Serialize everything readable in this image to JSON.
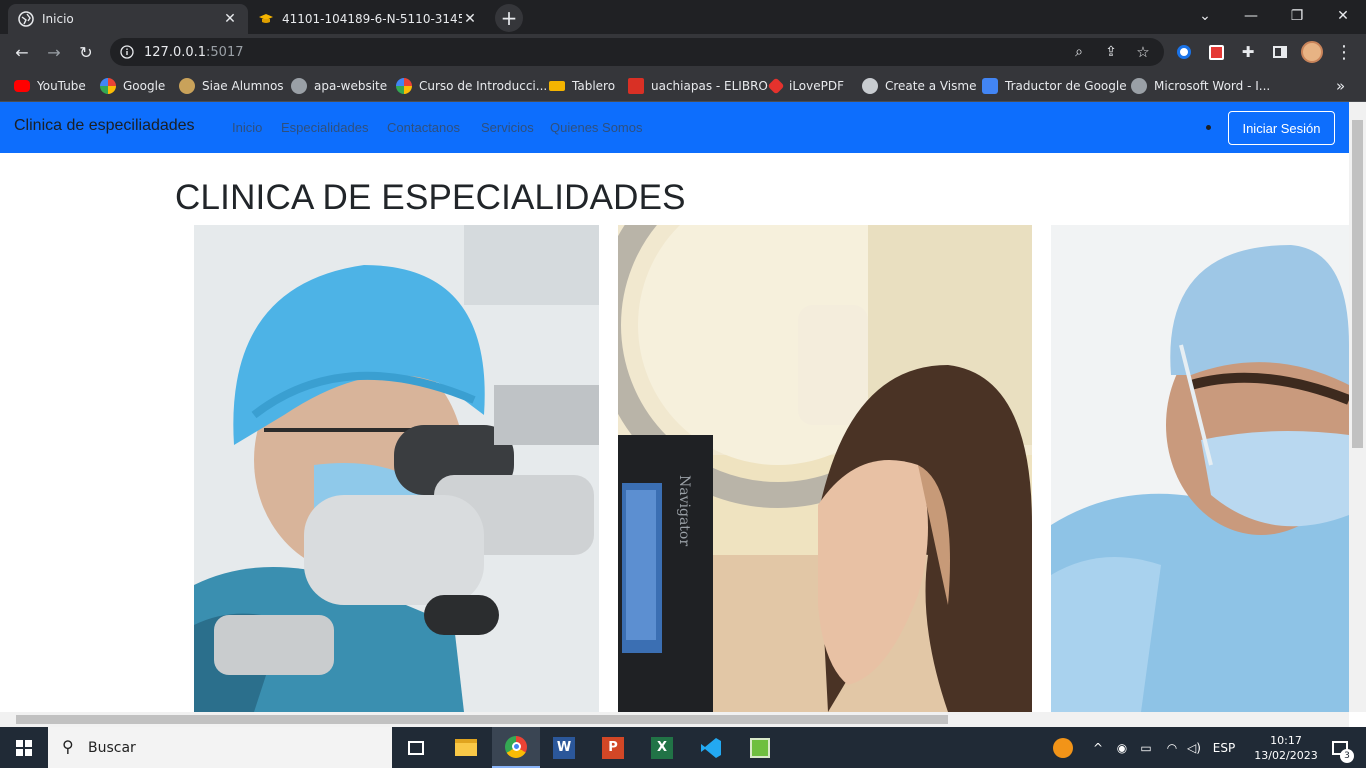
{
  "browser": {
    "tabs": [
      {
        "title": "Inicio",
        "active": true
      },
      {
        "title": "41101-104189-6-N-5110-31452",
        "active": false
      }
    ],
    "url_host": "127.0.0.1",
    "url_port": ":5017",
    "new_tab": "+",
    "bookmarks": [
      "YouTube",
      "Google",
      "Siae Alumnos",
      "apa-website",
      "Curso de Introducci...",
      "Tablero",
      "uachiapas - ELIBRO",
      "iLovePDF",
      "Create a Visme",
      "Traductor de Google",
      "Microsoft Word - I..."
    ],
    "bookmarks_more": "»"
  },
  "site": {
    "brand": "Clinica de especiliadades",
    "nav": [
      "Inicio",
      "Especialidades",
      "Contactanos",
      "Servicios",
      "Quienes Somos"
    ],
    "login": "Iniciar Sesión",
    "heading": "CLINICA DE ESPECIALIDADES",
    "monitor_text": "Navigator"
  },
  "taskbar": {
    "search_placeholder": "Buscar",
    "language": "ESP",
    "time": "10:17",
    "date": "13/02/2023",
    "notifications": "3"
  }
}
